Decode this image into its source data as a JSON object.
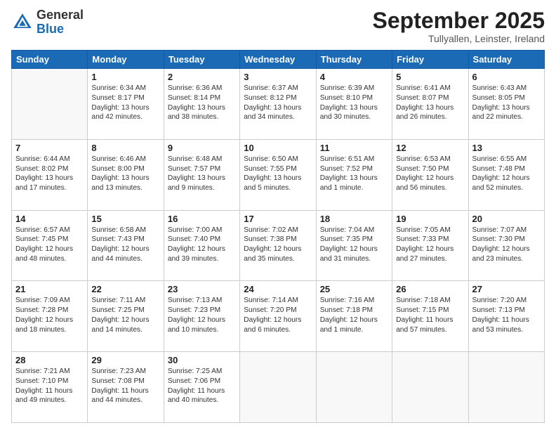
{
  "logo": {
    "general": "General",
    "blue": "Blue"
  },
  "header": {
    "month": "September 2025",
    "location": "Tullyallen, Leinster, Ireland"
  },
  "days": [
    "Sunday",
    "Monday",
    "Tuesday",
    "Wednesday",
    "Thursday",
    "Friday",
    "Saturday"
  ],
  "weeks": [
    [
      {
        "day": "",
        "sunrise": "",
        "sunset": "",
        "daylight": ""
      },
      {
        "day": "1",
        "sunrise": "Sunrise: 6:34 AM",
        "sunset": "Sunset: 8:17 PM",
        "daylight": "Daylight: 13 hours and 42 minutes."
      },
      {
        "day": "2",
        "sunrise": "Sunrise: 6:36 AM",
        "sunset": "Sunset: 8:14 PM",
        "daylight": "Daylight: 13 hours and 38 minutes."
      },
      {
        "day": "3",
        "sunrise": "Sunrise: 6:37 AM",
        "sunset": "Sunset: 8:12 PM",
        "daylight": "Daylight: 13 hours and 34 minutes."
      },
      {
        "day": "4",
        "sunrise": "Sunrise: 6:39 AM",
        "sunset": "Sunset: 8:10 PM",
        "daylight": "Daylight: 13 hours and 30 minutes."
      },
      {
        "day": "5",
        "sunrise": "Sunrise: 6:41 AM",
        "sunset": "Sunset: 8:07 PM",
        "daylight": "Daylight: 13 hours and 26 minutes."
      },
      {
        "day": "6",
        "sunrise": "Sunrise: 6:43 AM",
        "sunset": "Sunset: 8:05 PM",
        "daylight": "Daylight: 13 hours and 22 minutes."
      }
    ],
    [
      {
        "day": "7",
        "sunrise": "Sunrise: 6:44 AM",
        "sunset": "Sunset: 8:02 PM",
        "daylight": "Daylight: 13 hours and 17 minutes."
      },
      {
        "day": "8",
        "sunrise": "Sunrise: 6:46 AM",
        "sunset": "Sunset: 8:00 PM",
        "daylight": "Daylight: 13 hours and 13 minutes."
      },
      {
        "day": "9",
        "sunrise": "Sunrise: 6:48 AM",
        "sunset": "Sunset: 7:57 PM",
        "daylight": "Daylight: 13 hours and 9 minutes."
      },
      {
        "day": "10",
        "sunrise": "Sunrise: 6:50 AM",
        "sunset": "Sunset: 7:55 PM",
        "daylight": "Daylight: 13 hours and 5 minutes."
      },
      {
        "day": "11",
        "sunrise": "Sunrise: 6:51 AM",
        "sunset": "Sunset: 7:52 PM",
        "daylight": "Daylight: 13 hours and 1 minute."
      },
      {
        "day": "12",
        "sunrise": "Sunrise: 6:53 AM",
        "sunset": "Sunset: 7:50 PM",
        "daylight": "Daylight: 12 hours and 56 minutes."
      },
      {
        "day": "13",
        "sunrise": "Sunrise: 6:55 AM",
        "sunset": "Sunset: 7:48 PM",
        "daylight": "Daylight: 12 hours and 52 minutes."
      }
    ],
    [
      {
        "day": "14",
        "sunrise": "Sunrise: 6:57 AM",
        "sunset": "Sunset: 7:45 PM",
        "daylight": "Daylight: 12 hours and 48 minutes."
      },
      {
        "day": "15",
        "sunrise": "Sunrise: 6:58 AM",
        "sunset": "Sunset: 7:43 PM",
        "daylight": "Daylight: 12 hours and 44 minutes."
      },
      {
        "day": "16",
        "sunrise": "Sunrise: 7:00 AM",
        "sunset": "Sunset: 7:40 PM",
        "daylight": "Daylight: 12 hours and 39 minutes."
      },
      {
        "day": "17",
        "sunrise": "Sunrise: 7:02 AM",
        "sunset": "Sunset: 7:38 PM",
        "daylight": "Daylight: 12 hours and 35 minutes."
      },
      {
        "day": "18",
        "sunrise": "Sunrise: 7:04 AM",
        "sunset": "Sunset: 7:35 PM",
        "daylight": "Daylight: 12 hours and 31 minutes."
      },
      {
        "day": "19",
        "sunrise": "Sunrise: 7:05 AM",
        "sunset": "Sunset: 7:33 PM",
        "daylight": "Daylight: 12 hours and 27 minutes."
      },
      {
        "day": "20",
        "sunrise": "Sunrise: 7:07 AM",
        "sunset": "Sunset: 7:30 PM",
        "daylight": "Daylight: 12 hours and 23 minutes."
      }
    ],
    [
      {
        "day": "21",
        "sunrise": "Sunrise: 7:09 AM",
        "sunset": "Sunset: 7:28 PM",
        "daylight": "Daylight: 12 hours and 18 minutes."
      },
      {
        "day": "22",
        "sunrise": "Sunrise: 7:11 AM",
        "sunset": "Sunset: 7:25 PM",
        "daylight": "Daylight: 12 hours and 14 minutes."
      },
      {
        "day": "23",
        "sunrise": "Sunrise: 7:13 AM",
        "sunset": "Sunset: 7:23 PM",
        "daylight": "Daylight: 12 hours and 10 minutes."
      },
      {
        "day": "24",
        "sunrise": "Sunrise: 7:14 AM",
        "sunset": "Sunset: 7:20 PM",
        "daylight": "Daylight: 12 hours and 6 minutes."
      },
      {
        "day": "25",
        "sunrise": "Sunrise: 7:16 AM",
        "sunset": "Sunset: 7:18 PM",
        "daylight": "Daylight: 12 hours and 1 minute."
      },
      {
        "day": "26",
        "sunrise": "Sunrise: 7:18 AM",
        "sunset": "Sunset: 7:15 PM",
        "daylight": "Daylight: 11 hours and 57 minutes."
      },
      {
        "day": "27",
        "sunrise": "Sunrise: 7:20 AM",
        "sunset": "Sunset: 7:13 PM",
        "daylight": "Daylight: 11 hours and 53 minutes."
      }
    ],
    [
      {
        "day": "28",
        "sunrise": "Sunrise: 7:21 AM",
        "sunset": "Sunset: 7:10 PM",
        "daylight": "Daylight: 11 hours and 49 minutes."
      },
      {
        "day": "29",
        "sunrise": "Sunrise: 7:23 AM",
        "sunset": "Sunset: 7:08 PM",
        "daylight": "Daylight: 11 hours and 44 minutes."
      },
      {
        "day": "30",
        "sunrise": "Sunrise: 7:25 AM",
        "sunset": "Sunset: 7:06 PM",
        "daylight": "Daylight: 11 hours and 40 minutes."
      },
      {
        "day": "",
        "sunrise": "",
        "sunset": "",
        "daylight": ""
      },
      {
        "day": "",
        "sunrise": "",
        "sunset": "",
        "daylight": ""
      },
      {
        "day": "",
        "sunrise": "",
        "sunset": "",
        "daylight": ""
      },
      {
        "day": "",
        "sunrise": "",
        "sunset": "",
        "daylight": ""
      }
    ]
  ]
}
